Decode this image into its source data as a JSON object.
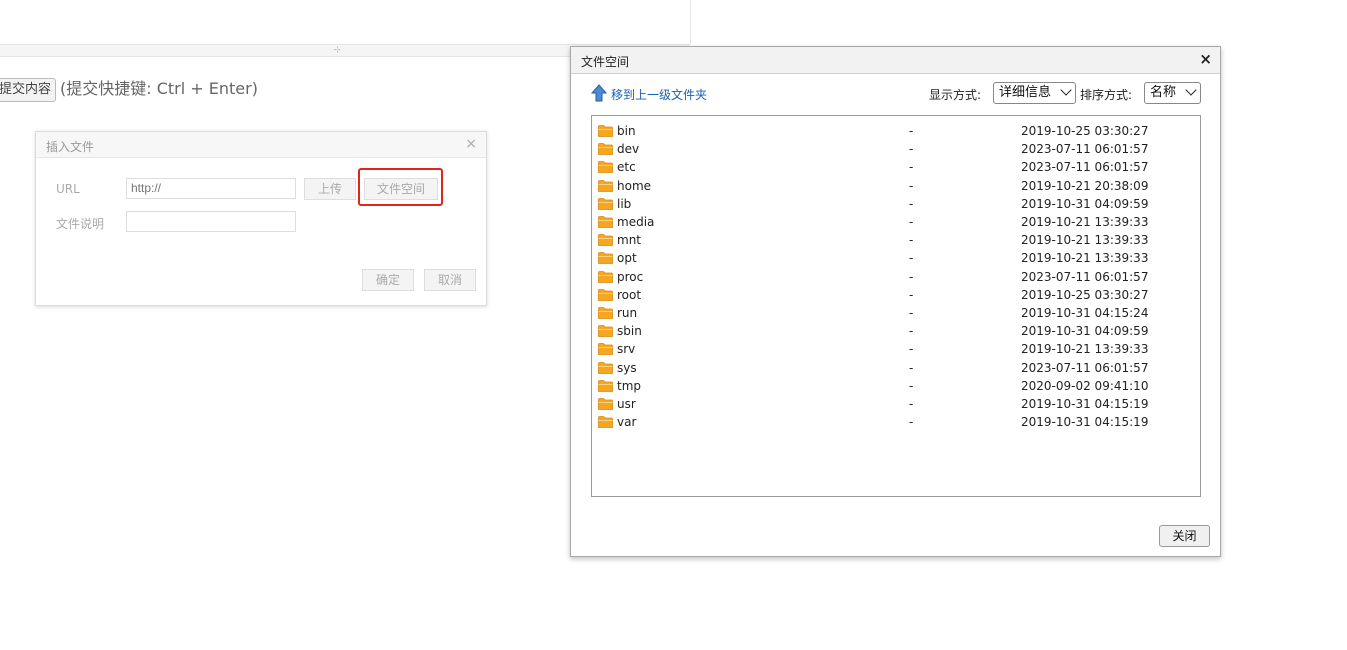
{
  "editor": {
    "submit_label": "提交内容",
    "submit_hint": "(提交快捷键: Ctrl + Enter)"
  },
  "insert_dialog": {
    "title": "插入文件",
    "close_glyph": "×",
    "url_label": "URL",
    "url_placeholder": "http://",
    "upload_label": "上传",
    "file_space_label": "文件空间",
    "description_label": "文件说明",
    "description_value": "",
    "ok_label": "确定",
    "cancel_label": "取消"
  },
  "file_space": {
    "title": "文件空间",
    "close_glyph": "×",
    "up_link": "移到上一级文件夹",
    "view_label": "显示方式:",
    "view_value": "详细信息",
    "sort_label": "排序方式:",
    "sort_value": "名称",
    "close_button": "关闭",
    "files": [
      {
        "name": "bin",
        "size": "-",
        "date": "2019-10-25 03:30:27"
      },
      {
        "name": "dev",
        "size": "-",
        "date": "2023-07-11 06:01:57"
      },
      {
        "name": "etc",
        "size": "-",
        "date": "2023-07-11 06:01:57"
      },
      {
        "name": "home",
        "size": "-",
        "date": "2019-10-21 20:38:09"
      },
      {
        "name": "lib",
        "size": "-",
        "date": "2019-10-31 04:09:59"
      },
      {
        "name": "media",
        "size": "-",
        "date": "2019-10-21 13:39:33"
      },
      {
        "name": "mnt",
        "size": "-",
        "date": "2019-10-21 13:39:33"
      },
      {
        "name": "opt",
        "size": "-",
        "date": "2019-10-21 13:39:33"
      },
      {
        "name": "proc",
        "size": "-",
        "date": "2023-07-11 06:01:57"
      },
      {
        "name": "root",
        "size": "-",
        "date": "2019-10-25 03:30:27"
      },
      {
        "name": "run",
        "size": "-",
        "date": "2019-10-31 04:15:24"
      },
      {
        "name": "sbin",
        "size": "-",
        "date": "2019-10-31 04:09:59"
      },
      {
        "name": "srv",
        "size": "-",
        "date": "2019-10-21 13:39:33"
      },
      {
        "name": "sys",
        "size": "-",
        "date": "2023-07-11 06:01:57"
      },
      {
        "name": "tmp",
        "size": "-",
        "date": "2020-09-02 09:41:10"
      },
      {
        "name": "usr",
        "size": "-",
        "date": "2019-10-31 04:15:19"
      },
      {
        "name": "var",
        "size": "-",
        "date": "2019-10-31 04:15:19"
      }
    ]
  },
  "colors": {
    "folder": "#f5a623",
    "link": "#1a5fb4",
    "highlight": "#e1251b"
  }
}
